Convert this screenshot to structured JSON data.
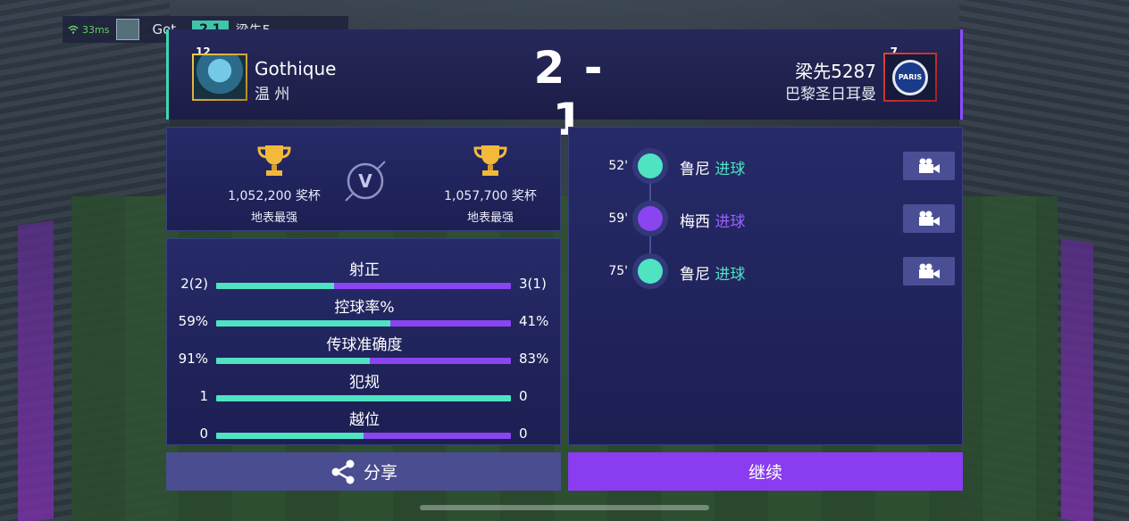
{
  "mini_bar": {
    "ping": "33ms",
    "home_name": "Got",
    "score": "2 1",
    "away_name": "梁先5"
  },
  "header": {
    "home": {
      "level": "12",
      "name": "Gothique",
      "city": "温 州"
    },
    "score": "2 - 1",
    "away": {
      "level": "7",
      "name": "梁先5287",
      "club": "巴黎圣日耳曼",
      "crest_text": "PARIS"
    }
  },
  "trophies": {
    "home": {
      "count": "1,052,200 奖杯",
      "title": "地表最强"
    },
    "away": {
      "count": "1,057,700 奖杯",
      "title": "地表最强"
    },
    "vs_label": "V"
  },
  "stats": [
    {
      "label": "射正",
      "home": "2(2)",
      "away": "3(1)",
      "home_fraction": 0.4
    },
    {
      "label": "控球率%",
      "home": "59%",
      "away": "41%",
      "home_fraction": 0.59
    },
    {
      "label": "传球准确度",
      "home": "91%",
      "away": "83%",
      "home_fraction": 0.52
    },
    {
      "label": "犯规",
      "home": "1",
      "away": "0",
      "home_fraction": 1.0
    },
    {
      "label": "越位",
      "home": "0",
      "away": "0",
      "home_fraction": 0.5
    }
  ],
  "events": [
    {
      "minute": "52'",
      "player": "鲁尼",
      "tag": "进球",
      "side": "home"
    },
    {
      "minute": "59'",
      "player": "梅西",
      "tag": "进球",
      "side": "away"
    },
    {
      "minute": "75'",
      "player": "鲁尼",
      "tag": "进球",
      "side": "home"
    }
  ],
  "buttons": {
    "share": "分享",
    "continue": "继续"
  },
  "colors": {
    "home_accent": "#4fe3c2",
    "away_accent": "#8a45f0",
    "panel_bg": "#1c1f52",
    "continue_bg": "#8a3cf0"
  }
}
